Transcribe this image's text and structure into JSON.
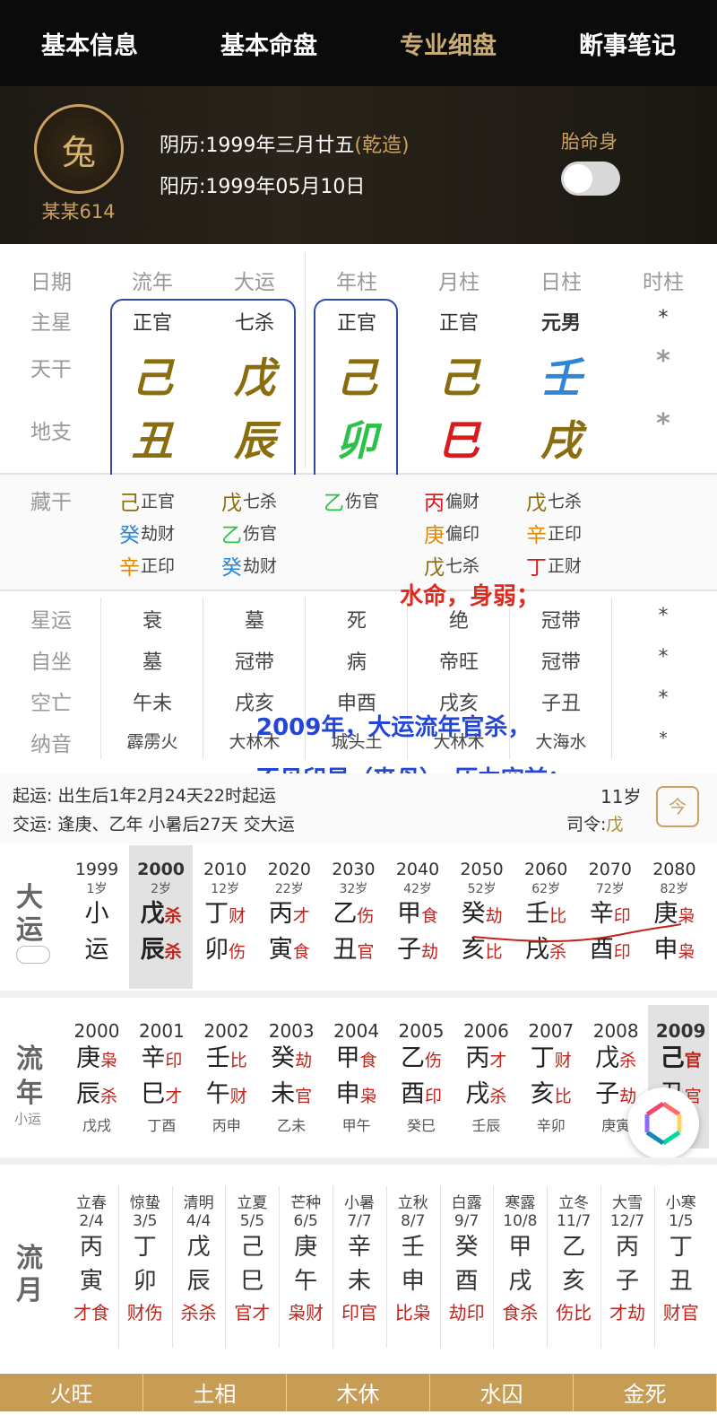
{
  "nav": {
    "tabs": [
      "基本信息",
      "基本命盘",
      "专业细盘",
      "断事笔记"
    ]
  },
  "profile": {
    "name": "某某614",
    "lunar_label": "阴历:",
    "lunar_value": "1999年三月廿五",
    "lunar_tag": "(乾造)",
    "solar_label": "阳历:",
    "solar_value": "1999年05月10日",
    "taimingshen": "胎命身"
  },
  "pillars": {
    "headers": [
      "日期",
      "流年",
      "大运",
      "年柱",
      "月柱",
      "日柱",
      "时柱"
    ],
    "row_labels": [
      "主星",
      "天干",
      "地支"
    ],
    "main_star": [
      "正官",
      "七杀",
      "正官",
      "正官",
      "元男",
      "*"
    ],
    "stems": [
      "己",
      "戊",
      "己",
      "己",
      "壬",
      "*"
    ],
    "branches": [
      "丑",
      "辰",
      "卯",
      "巳",
      "戌",
      "*"
    ],
    "colors": {
      "earth": "#8a6d0e",
      "wood": "#2cc148",
      "fire": "#d81b1b",
      "water": "#2f86d6",
      "gray": "#9a9a9a"
    }
  },
  "hidden": {
    "label": "藏干",
    "cols": [
      [
        {
          "g": "己",
          "s": "正官"
        },
        {
          "g": "癸",
          "s": "劫财"
        },
        {
          "g": "辛",
          "s": "正印"
        }
      ],
      [
        {
          "g": "戊",
          "s": "七杀"
        },
        {
          "g": "乙",
          "s": "伤官"
        },
        {
          "g": "癸",
          "s": "劫财"
        }
      ],
      [
        {
          "g": "乙",
          "s": "伤官"
        }
      ],
      [
        {
          "g": "丙",
          "s": "偏财"
        },
        {
          "g": "庚",
          "s": "偏印"
        },
        {
          "g": "戊",
          "s": "七杀"
        }
      ],
      [
        {
          "g": "戊",
          "s": "七杀"
        },
        {
          "g": "辛",
          "s": "正印"
        },
        {
          "g": "丁",
          "s": "正财"
        }
      ]
    ]
  },
  "info_rows": [
    {
      "label": "星运",
      "vals": [
        "衰",
        "墓",
        "死",
        "绝",
        "冠带",
        "*"
      ]
    },
    {
      "label": "自坐",
      "vals": [
        "墓",
        "冠带",
        "病",
        "帝旺",
        "冠带",
        "*"
      ]
    },
    {
      "label": "空亡",
      "vals": [
        "午未",
        "戌亥",
        "申酉",
        "戌亥",
        "子丑",
        "*"
      ]
    },
    {
      "label": "纳音",
      "vals": [
        "霹雳火",
        "大林木",
        "城头土",
        "大林木",
        "大海水",
        "*"
      ]
    }
  ],
  "annotations": {
    "a1": "水命，身弱；",
    "a2": "2009年，大运流年官杀，",
    "a3": "不见印星（丧母），压力空前；"
  },
  "start": {
    "qiyun_label": "起运:",
    "qiyun_value": "出生后1年2月24天22时起运",
    "age": "11岁",
    "jiaoyun_label": "交运:",
    "jiaoyun_value": "逢庚、乙年 小暑后27天 交大运",
    "siling_label": "司令:",
    "siling_value": "戊",
    "today": "今"
  },
  "dayun": {
    "label1": "大",
    "label2": "运",
    "cols": [
      {
        "year": "1999",
        "age": "1岁",
        "g": "小",
        "gs": "",
        "z": "运",
        "zs": ""
      },
      {
        "year": "2000",
        "age": "2岁",
        "g": "戊",
        "gs": "杀",
        "z": "辰",
        "zs": "杀"
      },
      {
        "year": "2010",
        "age": "12岁",
        "g": "丁",
        "gs": "财",
        "z": "卯",
        "zs": "伤"
      },
      {
        "year": "2020",
        "age": "22岁",
        "g": "丙",
        "gs": "才",
        "z": "寅",
        "zs": "食"
      },
      {
        "year": "2030",
        "age": "32岁",
        "g": "乙",
        "gs": "伤",
        "z": "丑",
        "zs": "官"
      },
      {
        "year": "2040",
        "age": "42岁",
        "g": "甲",
        "gs": "食",
        "z": "子",
        "zs": "劫"
      },
      {
        "year": "2050",
        "age": "52岁",
        "g": "癸",
        "gs": "劫",
        "z": "亥",
        "zs": "比"
      },
      {
        "year": "2060",
        "age": "62岁",
        "g": "壬",
        "gs": "比",
        "z": "戌",
        "zs": "杀"
      },
      {
        "year": "2070",
        "age": "72岁",
        "g": "辛",
        "gs": "印",
        "z": "酉",
        "zs": "印"
      },
      {
        "year": "2080",
        "age": "82岁",
        "g": "庚",
        "gs": "枭",
        "z": "申",
        "zs": "枭"
      }
    ]
  },
  "liunian": {
    "label1": "流",
    "label2": "年",
    "sub": "小运",
    "cols": [
      {
        "year": "2000",
        "g": "庚",
        "gs": "枭",
        "z": "辰",
        "zs": "杀",
        "xy": "戊戌"
      },
      {
        "year": "2001",
        "g": "辛",
        "gs": "印",
        "z": "巳",
        "zs": "才",
        "xy": "丁酉"
      },
      {
        "year": "2002",
        "g": "壬",
        "gs": "比",
        "z": "午",
        "zs": "财",
        "xy": "丙申"
      },
      {
        "year": "2003",
        "g": "癸",
        "gs": "劫",
        "z": "未",
        "zs": "官",
        "xy": "乙未"
      },
      {
        "year": "2004",
        "g": "甲",
        "gs": "食",
        "z": "申",
        "zs": "枭",
        "xy": "甲午"
      },
      {
        "year": "2005",
        "g": "乙",
        "gs": "伤",
        "z": "酉",
        "zs": "印",
        "xy": "癸巳"
      },
      {
        "year": "2006",
        "g": "丙",
        "gs": "才",
        "z": "戌",
        "zs": "杀",
        "xy": "壬辰"
      },
      {
        "year": "2007",
        "g": "丁",
        "gs": "财",
        "z": "亥",
        "zs": "比",
        "xy": "辛卯"
      },
      {
        "year": "2008",
        "g": "戊",
        "gs": "杀",
        "z": "子",
        "zs": "劫",
        "xy": "庚寅"
      },
      {
        "year": "2009",
        "g": "己",
        "gs": "官",
        "z": "丑",
        "zs": "官",
        "xy": ""
      }
    ]
  },
  "liuyue": {
    "label1": "流",
    "label2": "月",
    "cols": [
      {
        "jq": "立春",
        "d": "2/4",
        "g": "丙",
        "z": "寅",
        "ss": "才食"
      },
      {
        "jq": "惊蛰",
        "d": "3/5",
        "g": "丁",
        "z": "卯",
        "ss": "财伤"
      },
      {
        "jq": "清明",
        "d": "4/4",
        "g": "戊",
        "z": "辰",
        "ss": "杀杀"
      },
      {
        "jq": "立夏",
        "d": "5/5",
        "g": "己",
        "z": "巳",
        "ss": "官才"
      },
      {
        "jq": "芒种",
        "d": "6/5",
        "g": "庚",
        "z": "午",
        "ss": "枭财"
      },
      {
        "jq": "小暑",
        "d": "7/7",
        "g": "辛",
        "z": "未",
        "ss": "印官"
      },
      {
        "jq": "立秋",
        "d": "8/7",
        "g": "壬",
        "z": "申",
        "ss": "比枭"
      },
      {
        "jq": "白露",
        "d": "9/7",
        "g": "癸",
        "z": "酉",
        "ss": "劫印"
      },
      {
        "jq": "寒露",
        "d": "10/8",
        "g": "甲",
        "z": "戌",
        "ss": "食杀"
      },
      {
        "jq": "立冬",
        "d": "11/7",
        "g": "乙",
        "z": "亥",
        "ss": "伤比"
      },
      {
        "jq": "大雪",
        "d": "12/7",
        "g": "丙",
        "z": "子",
        "ss": "才劫"
      },
      {
        "jq": "小寒",
        "d": "1/5",
        "g": "丁",
        "z": "丑",
        "ss": "财官"
      }
    ]
  },
  "wuxing": [
    "火旺",
    "土相",
    "木休",
    "水囚",
    "金死"
  ]
}
